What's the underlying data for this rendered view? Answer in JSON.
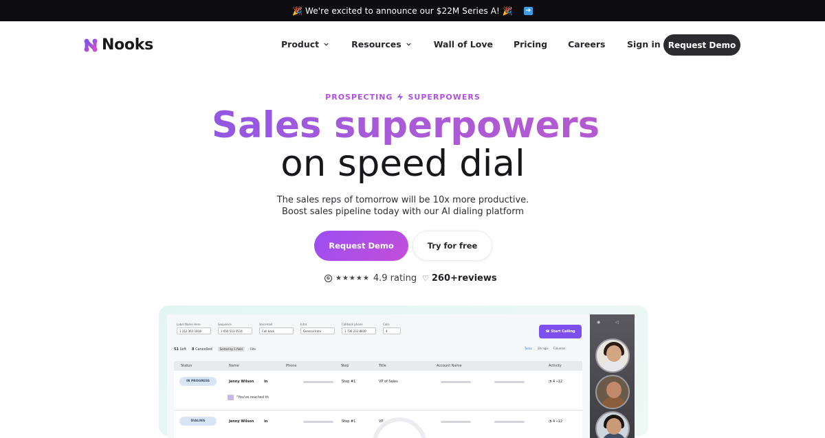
{
  "announcement": {
    "text": "🎉 We're excited to announce our $22M Series A! 🎉",
    "arrow": "➡️"
  },
  "nav": {
    "logo_text": "Nooks",
    "items": [
      {
        "label": "Product",
        "has_dropdown": true
      },
      {
        "label": "Resources",
        "has_dropdown": true
      },
      {
        "label": "Wall of Love",
        "has_dropdown": false
      },
      {
        "label": "Pricing",
        "has_dropdown": false
      },
      {
        "label": "Careers",
        "has_dropdown": false
      }
    ],
    "sign_in": "Sign in",
    "request_demo": "Request Demo"
  },
  "hero": {
    "eyebrow_left": "PROSPECTING",
    "eyebrow_icon": "lightning-bolt-icon",
    "eyebrow_right": "SUPERPOWERS",
    "title_line1": "Sales superpowers",
    "title_line2": "on speed dial",
    "subtitle_line1": "The sales reps of tomorrow will be 10x more productive.",
    "subtitle_line2": "Boost sales pipeline today with our AI dialing platform",
    "primary_cta": "Request Demo",
    "secondary_cta": "Try for free",
    "rating_logo": "G",
    "stars": "★★★★★",
    "rating_text": "4.9 rating",
    "reviews_text": "260+reviews"
  },
  "preview": {
    "filters": [
      {
        "label": "Label Name Here",
        "value": "1 212 361 1818"
      },
      {
        "label": "Sequence",
        "value": "1 650 513 0514"
      },
      {
        "label": "Voicemail",
        "value": "Call back"
      },
      {
        "label": "Intro",
        "value": "General Intro"
      },
      {
        "label": "Callback phone",
        "value": "1 736 231 8830"
      },
      {
        "label": "Calls",
        "value": "4"
      }
    ],
    "start_calling": "Start Calling",
    "counts": {
      "left_num": "51",
      "left_label": "Left",
      "cancelled_num": "8",
      "cancelled_label": "Cancelled",
      "sorted": "Sorted by 1 field",
      "filter": "Filte"
    },
    "tasks": {
      "tasks": "Tasks",
      "ago": "1m ago",
      "columns": "Columns"
    },
    "columns": [
      "Status",
      "Name",
      "Phone",
      "Step",
      "Title",
      "Account Name",
      "Activity"
    ],
    "rows": [
      {
        "status": "IN PROGRESS",
        "name": "Jenny Wilson",
        "step": "Step #1",
        "title": "VP of Sales",
        "calls": "4",
        "links": "12",
        "note": "\"You've reached th"
      },
      {
        "status": "DIALING",
        "name": "Jenny Wilson",
        "step": "Step #1",
        "title": "VP",
        "calls": "4",
        "links": "12",
        "note": ""
      }
    ]
  },
  "colors": {
    "brand_purple": "#9b4ef2",
    "brand_pink": "#c34fd9",
    "dark": "#2b2b30"
  }
}
